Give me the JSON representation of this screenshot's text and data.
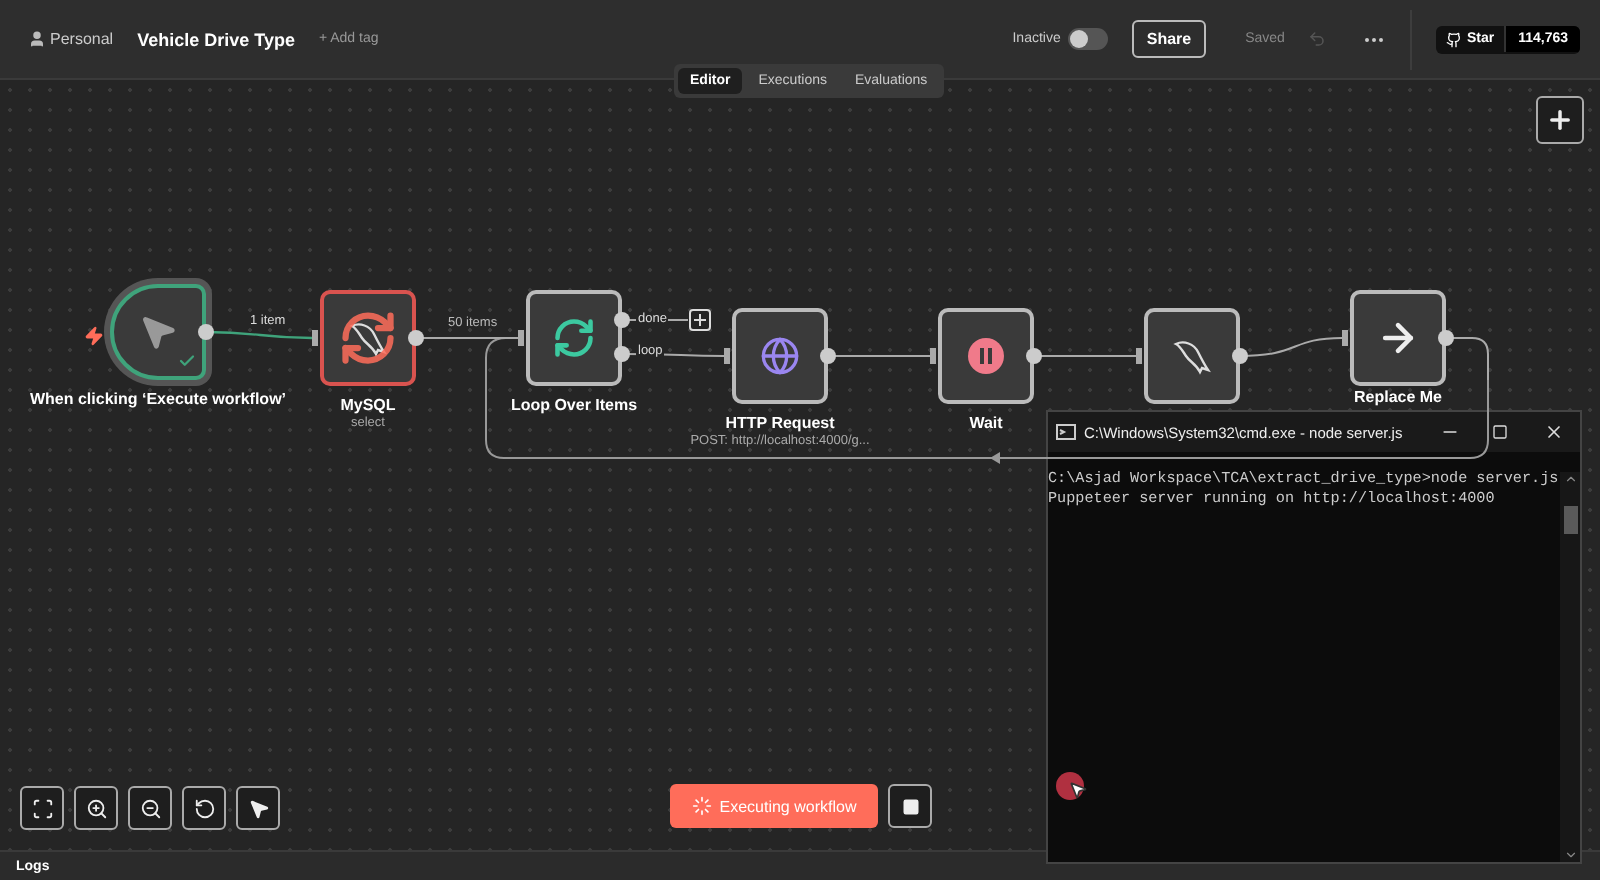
{
  "header": {
    "project": "Personal",
    "workflow_name": "Vehicle Drive Type",
    "add_tag": "+ Add tag",
    "status": {
      "label": "Inactive",
      "on": false
    },
    "share": "Share",
    "save_state": "Saved",
    "github": {
      "label": "Star",
      "count": "114,763"
    }
  },
  "tabs": [
    {
      "label": "Editor",
      "selected": true
    },
    {
      "label": "Executions",
      "selected": false
    },
    {
      "label": "Evaluations",
      "selected": false
    }
  ],
  "nodes": [
    {
      "kind": "trigger",
      "label": "When clicking ‘Execute workflow’",
      "executed": true,
      "running": false
    },
    {
      "kind": "mysql",
      "label": "MySQL",
      "subtitle": "select",
      "executed": false,
      "running": true
    },
    {
      "kind": "loop",
      "label": "Loop Over Items",
      "executed": false,
      "running": false,
      "outputs": [
        "done",
        "loop"
      ]
    },
    {
      "kind": "http",
      "label": "HTTP Request",
      "subtitle": "POST: http://localhost:4000/g...",
      "executed": false,
      "running": false
    },
    {
      "kind": "wait",
      "label": "Wait",
      "executed": false,
      "running": false
    },
    {
      "kind": "mysql",
      "executed": false,
      "running": false
    },
    {
      "kind": "noop",
      "label": "Replace Me",
      "executed": false,
      "running": false
    }
  ],
  "edges": [
    {
      "label": "1 item",
      "executed": true
    },
    {
      "label": "50 items",
      "executed": false
    }
  ],
  "execute_button": {
    "label": "Executing workflow",
    "running": true
  },
  "logs": "Logs",
  "terminal": {
    "title": "C:\\Windows\\System32\\cmd.exe - node  server.js",
    "lines": [
      "C:\\Asjad Workspace\\TCA\\extract_drive_type>node server.js",
      "Puppeteer server running on http://localhost:4000"
    ]
  }
}
